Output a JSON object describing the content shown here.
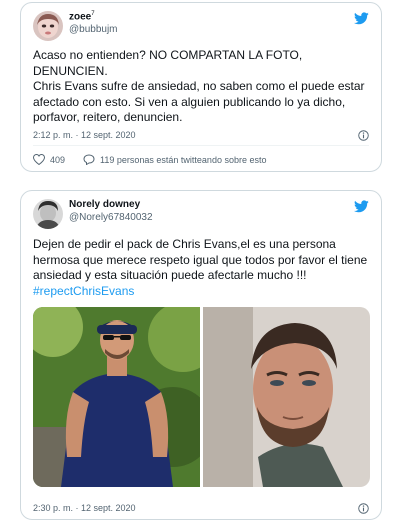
{
  "tweets": [
    {
      "name": "zoee",
      "name_mark": "7",
      "handle": "@bubbujm",
      "paragraphs": [
        "Acaso no entienden? NO COMPARTAN LA FOTO, DENUNCIEN.",
        "Chris Evans sufre de ansiedad, no saben como el puede estar afectado con esto. Si ven a alguien publicando lo ya dicho, porfavor, reitero, denuncien."
      ],
      "timestamp": "2:12 p. m. · 12 sept. 2020",
      "likes": "409",
      "talking": "119 personas están twitteando sobre esto"
    },
    {
      "name": "Norely downey",
      "handle": "@Norely67840032",
      "text": "Dejen de pedir el pack de Chris Evans,el es una persona hermosa que merece respeto igual que todos  por favor el tiene ansiedad y esta situación puede afectarle mucho !!!",
      "hashtag": "#repectChrisEvans",
      "timestamp": "2:30 p. m. · 12 sept. 2020"
    }
  ],
  "icons": {
    "logo": "twitter-bird-icon",
    "info": "info-icon",
    "like": "heart-icon",
    "reply": "speech-bubble-icon"
  },
  "colors": {
    "brand": "#1d9bf0",
    "text": "#0f1419",
    "muted": "#536471",
    "border": "#cfd9de"
  }
}
